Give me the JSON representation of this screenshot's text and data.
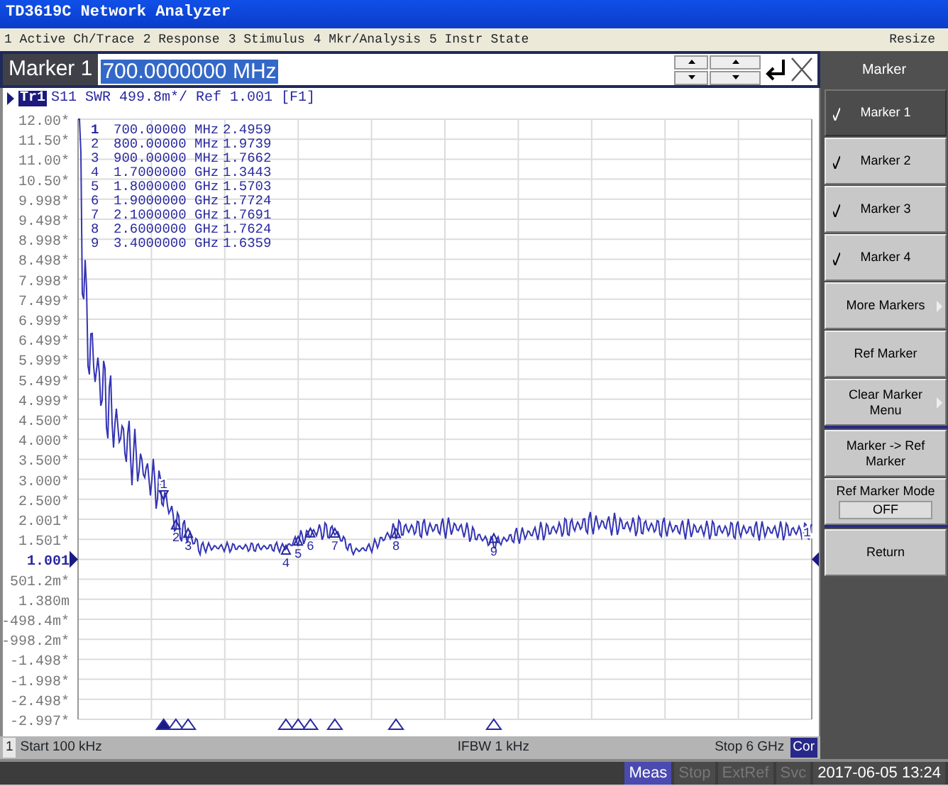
{
  "window": {
    "title": "TD3619C Network Analyzer"
  },
  "menu": {
    "items": [
      "1 Active Ch/Trace",
      "2 Response",
      "3 Stimulus",
      "4 Mkr/Analysis",
      "5 Instr State"
    ],
    "resize": "Resize"
  },
  "entry": {
    "label": "Marker 1",
    "value": "700.0000000 MHz"
  },
  "trace_header": {
    "trace": "Tr1",
    "description": "S11 SWR 499.8m*/ Ref 1.001 [F1]"
  },
  "y_axis_labels": [
    {
      "text": "12.00*",
      "kind": "tick"
    },
    {
      "text": "11.50*",
      "kind": "tick"
    },
    {
      "text": "11.00*",
      "kind": "tick"
    },
    {
      "text": "10.50*",
      "kind": "tick"
    },
    {
      "text": "9.998*",
      "kind": "tick"
    },
    {
      "text": "9.498*",
      "kind": "tick"
    },
    {
      "text": "8.998*",
      "kind": "tick"
    },
    {
      "text": "8.498*",
      "kind": "tick"
    },
    {
      "text": "7.998*",
      "kind": "tick"
    },
    {
      "text": "7.499*",
      "kind": "tick"
    },
    {
      "text": "6.999*",
      "kind": "tick"
    },
    {
      "text": "6.499*",
      "kind": "tick"
    },
    {
      "text": "5.999*",
      "kind": "tick"
    },
    {
      "text": "5.499*",
      "kind": "tick"
    },
    {
      "text": "4.999*",
      "kind": "tick"
    },
    {
      "text": "4.500*",
      "kind": "tick"
    },
    {
      "text": "4.000*",
      "kind": "tick"
    },
    {
      "text": "3.500*",
      "kind": "tick"
    },
    {
      "text": "3.000*",
      "kind": "tick"
    },
    {
      "text": "2.500*",
      "kind": "tick"
    },
    {
      "text": "2.001*",
      "kind": "tick"
    },
    {
      "text": "1.501*",
      "kind": "tick"
    },
    {
      "text": "1.001",
      "kind": "reference"
    },
    {
      "text": "501.2m*",
      "kind": "tick"
    },
    {
      "text": "1.380m",
      "kind": "tick"
    },
    {
      "text": "-498.4m*",
      "kind": "tick"
    },
    {
      "text": "-998.2m*",
      "kind": "tick"
    },
    {
      "text": "-1.498*",
      "kind": "tick"
    },
    {
      "text": "-1.998*",
      "kind": "tick"
    },
    {
      "text": "-2.498*",
      "kind": "tick"
    },
    {
      "text": "-2.997*",
      "kind": "tick"
    }
  ],
  "markers": [
    {
      "number": "1",
      "frequency": "700.00000 MHz",
      "value": "2.4959",
      "selected": true
    },
    {
      "number": "2",
      "frequency": "800.00000 MHz",
      "value": "1.9739",
      "selected": false
    },
    {
      "number": "3",
      "frequency": "900.00000 MHz",
      "value": "1.7662",
      "selected": false
    },
    {
      "number": "4",
      "frequency": "1.7000000 GHz",
      "value": "1.3443",
      "selected": false
    },
    {
      "number": "5",
      "frequency": "1.8000000 GHz",
      "value": "1.5703",
      "selected": false
    },
    {
      "number": "6",
      "frequency": "1.9000000 GHz",
      "value": "1.7724",
      "selected": false
    },
    {
      "number": "7",
      "frequency": "2.1000000 GHz",
      "value": "1.7691",
      "selected": false
    },
    {
      "number": "8",
      "frequency": "2.6000000 GHz",
      "value": "1.7624",
      "selected": false
    },
    {
      "number": "9",
      "frequency": "3.4000000 GHz",
      "value": "1.6359",
      "selected": false
    }
  ],
  "trace_marker_labels": [
    {
      "label": "1",
      "selected": true
    },
    {
      "label": "2",
      "selected": false
    },
    {
      "label": "3",
      "selected": false
    },
    {
      "label": "4",
      "selected": false
    },
    {
      "label": "5",
      "selected": false
    },
    {
      "label": "6",
      "selected": false
    },
    {
      "label": "7",
      "selected": false
    },
    {
      "label": "8",
      "selected": false
    },
    {
      "label": "9",
      "selected": false
    }
  ],
  "trace_end_label": "1",
  "status": {
    "channel": "1",
    "start": "Start 100 kHz",
    "ifbw": "IFBW 1 kHz",
    "stop": "Stop 6 GHz",
    "correction": "Cor"
  },
  "softkey_title": "Marker",
  "softkeys": [
    {
      "kind": "check",
      "label": "Marker 1",
      "checked": true,
      "selected": true,
      "divider_after": false
    },
    {
      "kind": "check",
      "label": "Marker 2",
      "checked": true,
      "selected": false,
      "divider_after": false
    },
    {
      "kind": "check",
      "label": "Marker 3",
      "checked": true,
      "selected": false,
      "divider_after": false
    },
    {
      "kind": "check",
      "label": "Marker 4",
      "checked": true,
      "selected": false,
      "divider_after": false
    },
    {
      "kind": "submenu",
      "label": "More Markers",
      "selected": false,
      "divider_after": false
    },
    {
      "kind": "plain",
      "label": "Ref Marker",
      "selected": false,
      "divider_after": false
    },
    {
      "kind": "submenu",
      "label": "Clear Marker Menu",
      "selected": false,
      "divider_after": true
    },
    {
      "kind": "plain",
      "label": "Marker -> Ref Marker",
      "selected": false,
      "divider_after": false
    },
    {
      "kind": "value",
      "label": "Ref Marker Mode",
      "value": "OFF",
      "selected": false,
      "divider_after": true
    },
    {
      "kind": "plain",
      "label": "Return",
      "selected": false,
      "divider_after": false
    }
  ],
  "indicators": [
    {
      "label": "Meas",
      "on": true
    },
    {
      "label": "Stop",
      "on": false
    },
    {
      "label": "ExtRef",
      "on": false
    },
    {
      "label": "Svc",
      "on": false
    }
  ],
  "datetime": "2017-06-05 13:24"
}
